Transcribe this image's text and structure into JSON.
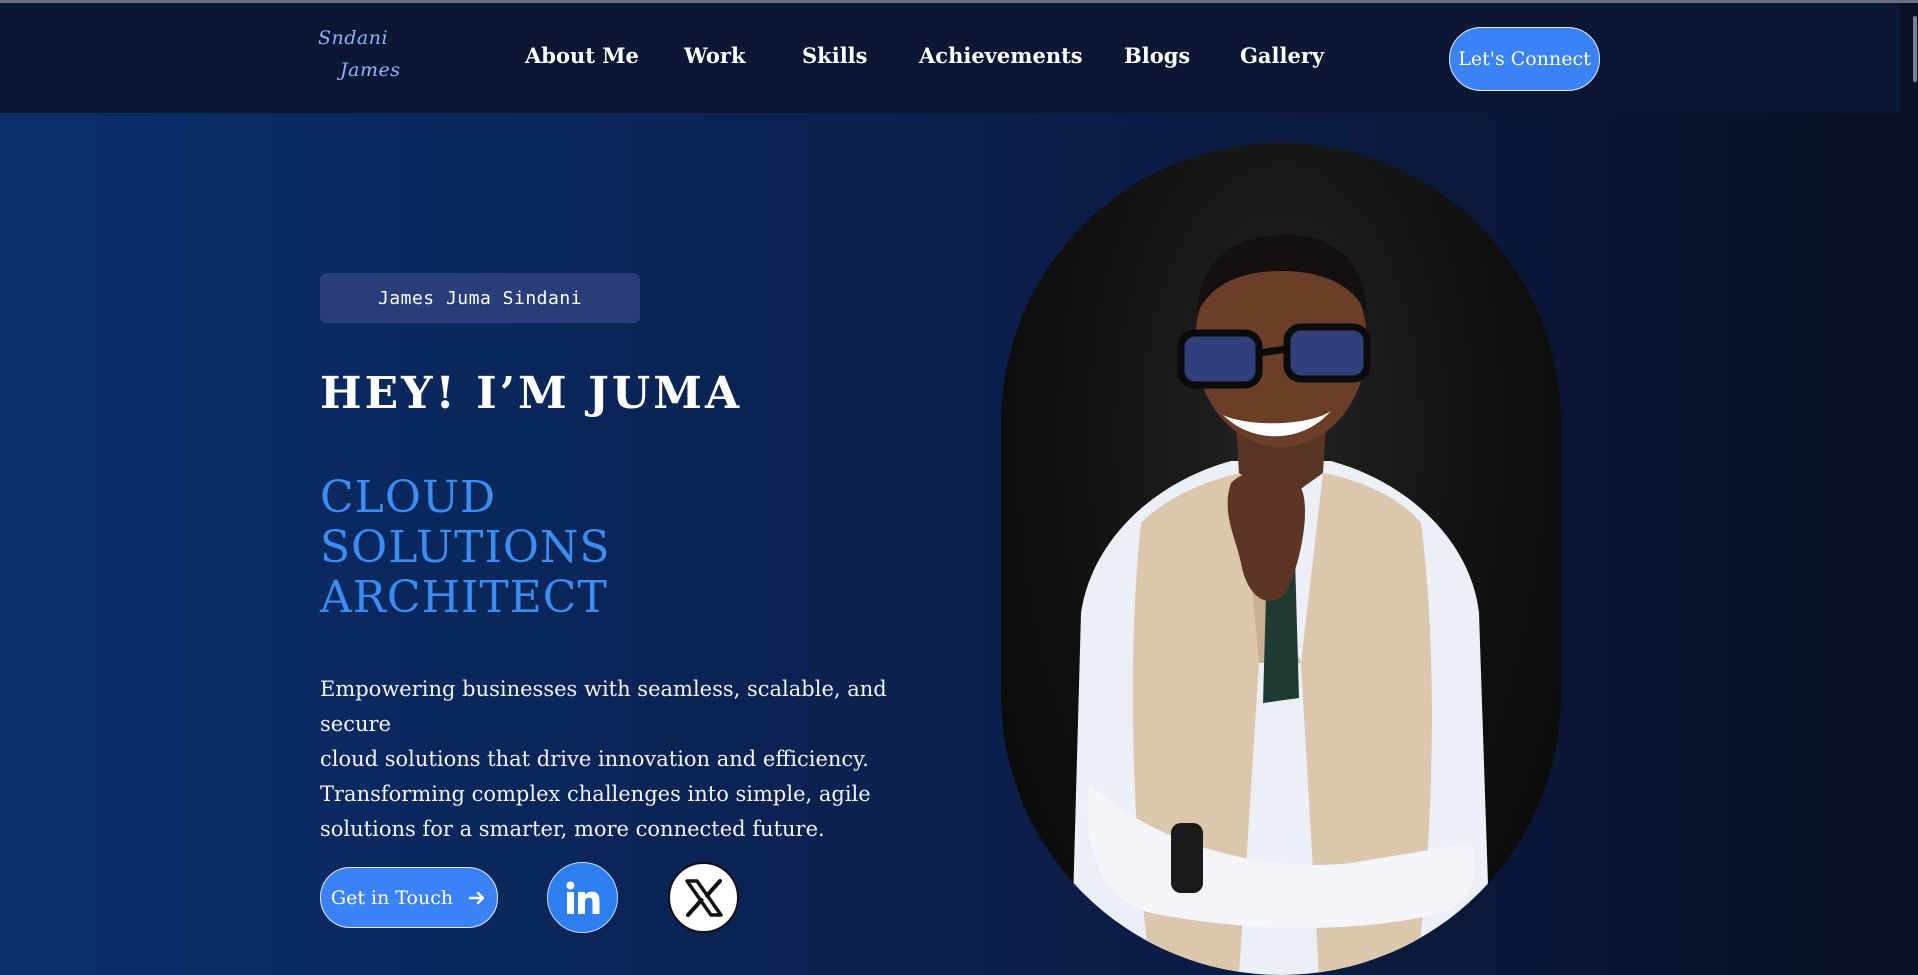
{
  "logo": {
    "line1": "Sndani",
    "line2": "James"
  },
  "nav": {
    "items": [
      {
        "label": "About Me"
      },
      {
        "label": "Work"
      },
      {
        "label": "Skills"
      },
      {
        "label": "Achievements"
      },
      {
        "label": "Blogs"
      },
      {
        "label": "Gallery"
      }
    ],
    "cta_label": "Let's Connect"
  },
  "hero": {
    "name_badge": "James Juma Sindani",
    "greeting": "HEY! I’M JUMA",
    "role_lines": [
      "CLOUD",
      "SOLUTIONS",
      "ARCHITECT"
    ],
    "description_lines": [
      "Empowering businesses with seamless, scalable, and secure",
      "cloud solutions that drive innovation and efficiency.",
      "Transforming complex challenges into simple, agile",
      "solutions for a smarter, more connected future."
    ],
    "get_in_touch_label": "Get in Touch"
  },
  "icons": {
    "arrow": "arrow-right-icon",
    "linkedin": "linkedin-icon",
    "x": "x-twitter-icon"
  },
  "colors": {
    "accent": "#3b82f6",
    "role_text": "#3b8df2",
    "header_bg": "#0b1733",
    "badge_bg": "#283d7a",
    "linkedin": "#2d7ff0"
  }
}
